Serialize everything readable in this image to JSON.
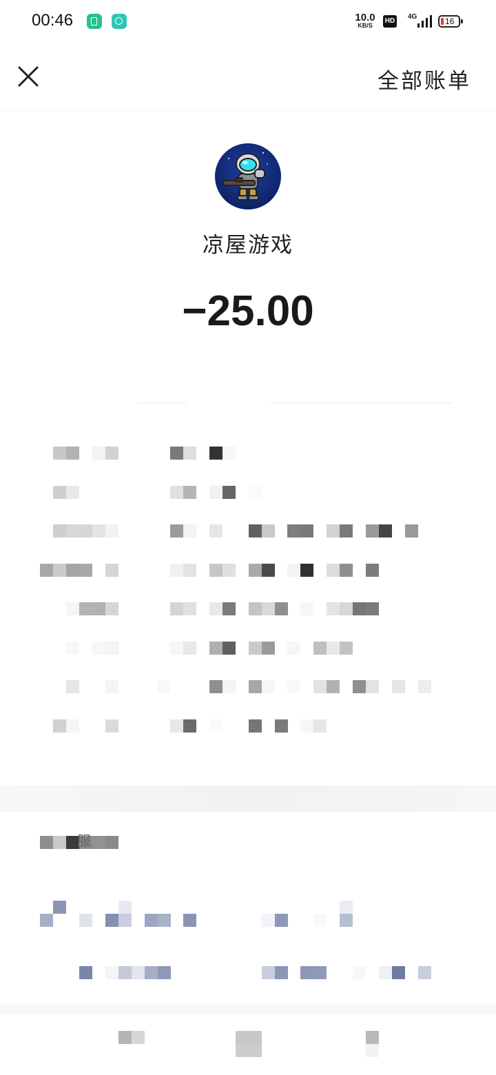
{
  "status_bar": {
    "time": "00:46",
    "net_speed_value": "10.0",
    "net_speed_unit": "KB/S",
    "hd_label": "HD",
    "network": "4G",
    "battery_level": "16"
  },
  "top_bar": {
    "all_bills_label": "全部账单"
  },
  "merchant": {
    "name": "凉屋游戏",
    "amount": "−25.00"
  },
  "service_section": {
    "label_fragment": "服"
  },
  "colors": {
    "battery_low": "#e53935",
    "app_icon_green": "#25c28a",
    "app_icon_teal": "#2cc7b4"
  }
}
